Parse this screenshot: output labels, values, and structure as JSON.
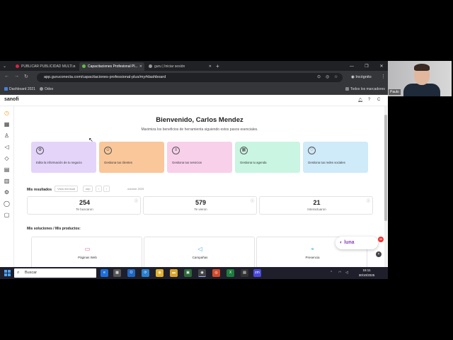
{
  "browser": {
    "tabs": [
      {
        "label": "PUBLICAR PUBLICIDAD MULTI..."
      },
      {
        "label": "Capacitaciones Profesional Pl..."
      },
      {
        "label": "guru | Iniciar sesión"
      }
    ],
    "url": "app.guruconecta.com/capacitaciones-professional-plus/my#dashboard",
    "incognito_label": "Incógnito",
    "bookmarks": [
      {
        "label": "Dashboard 2021"
      },
      {
        "label": "Odoo"
      }
    ],
    "all_bookmarks_label": "Todos los marcadores"
  },
  "app": {
    "brand": "sanofi",
    "welcome": "Bienvenido, Carlos Mendez",
    "subtitle": "Maximiza los beneficios de herramienta siguiendo estos pasos esenciales.",
    "actions": [
      {
        "label": "Edita la información de tu negocio",
        "color": "#e4d4fa",
        "icon": "gear-icon"
      },
      {
        "label": "Gestiona tus clientes",
        "color": "#f9c79a",
        "icon": "users-icon"
      },
      {
        "label": "Gestiona tus servicios",
        "color": "#f8d0ea",
        "icon": "services-icon"
      },
      {
        "label": "Gestiona tu agenda",
        "color": "#c9f5e2",
        "icon": "calendar-icon"
      },
      {
        "label": "Gestiona tus redes sociales",
        "color": "#cfeaf9",
        "icon": "heart-icon"
      }
    ],
    "results": {
      "title": "Mis resultados",
      "view_label": "Vista mensual",
      "month_short": "sep",
      "period": "octubre 2025"
    },
    "stats": [
      {
        "value": "254",
        "label": "Te buscaron"
      },
      {
        "value": "579",
        "label": "Te vieron"
      },
      {
        "value": "21",
        "label": "Interactuaron"
      }
    ],
    "solutions_title": "Mis soluciones / Mis productos:",
    "products": [
      {
        "label": "Páginas Web",
        "icon": "browser-icon"
      },
      {
        "label": "Campañas",
        "icon": "megaphone-icon"
      },
      {
        "label": "Presencia",
        "icon": "location-pin-icon"
      }
    ],
    "luna": {
      "label": "luna",
      "badge": "39"
    }
  },
  "webcam": {
    "name": "Paulo"
  },
  "taskbar": {
    "search_placeholder": "Buscar",
    "time": "15:11",
    "date": "30/10/2025"
  },
  "colors": {
    "accent": "#f0a020",
    "luna": "#8b3fbf"
  }
}
